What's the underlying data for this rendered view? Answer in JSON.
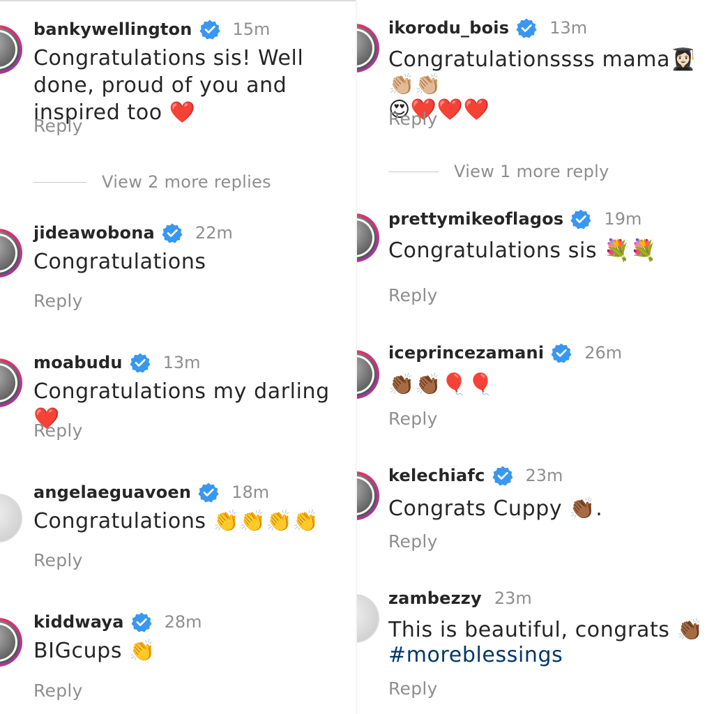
{
  "left_column": {
    "comments": [
      {
        "username": "bankywellington",
        "time": "15m",
        "text": "Congratulations sis! Well done, proud of you and inspired too ❤️",
        "reply_label": "Reply",
        "view_more_replies": "View 2 more replies"
      },
      {
        "username": "jideawobona",
        "time": "22m",
        "text": "Congratulations",
        "reply_label": "Reply"
      },
      {
        "username": "moabudu",
        "time": "13m",
        "text": "Congratulations my darling ❤️",
        "reply_label": "Reply"
      },
      {
        "username": "angelaeguavoen",
        "time": "18m",
        "text": "Congratulations 👏👏👏👏",
        "reply_label": "Reply"
      },
      {
        "username": "kiddwaya",
        "time": "28m",
        "text": "BIGcups 👏",
        "reply_label": "Reply"
      }
    ]
  },
  "right_column": {
    "comments": [
      {
        "username": "ikorodu_bois",
        "time": "13m",
        "text": "Congratulationssss mama👩🏻‍🎓👏🏼👏🏼\n😍❤️❤️❤️",
        "reply_label": "Reply",
        "view_more_replies": "View 1 more reply"
      },
      {
        "username": "prettymikeoflagos",
        "time": "19m",
        "text": "Congratulations sis 💐💐",
        "reply_label": "Reply"
      },
      {
        "username": "iceprincezamani",
        "time": "26m",
        "text": "👏🏾👏🏾🎈🎈",
        "reply_label": "Reply"
      },
      {
        "username": "kelechiafc",
        "time": "23m",
        "text": "Congrats Cuppy 👏🏾.",
        "reply_label": "Reply"
      },
      {
        "username": "zambezzy",
        "time": "23m",
        "text": "This is beautiful, congrats 👏🏾",
        "hashtag": "#moreblessings",
        "reply_label": "Reply"
      }
    ]
  },
  "colors": {
    "verified_badge": "#3897f0",
    "story_ring": [
      "#f9a11b",
      "#e1306c",
      "#833ab4"
    ],
    "secondary_text": "#8e8e8e",
    "hashtag": "#00376b"
  },
  "icons": {
    "verified": "verified-badge-icon",
    "avatar": "avatar"
  }
}
